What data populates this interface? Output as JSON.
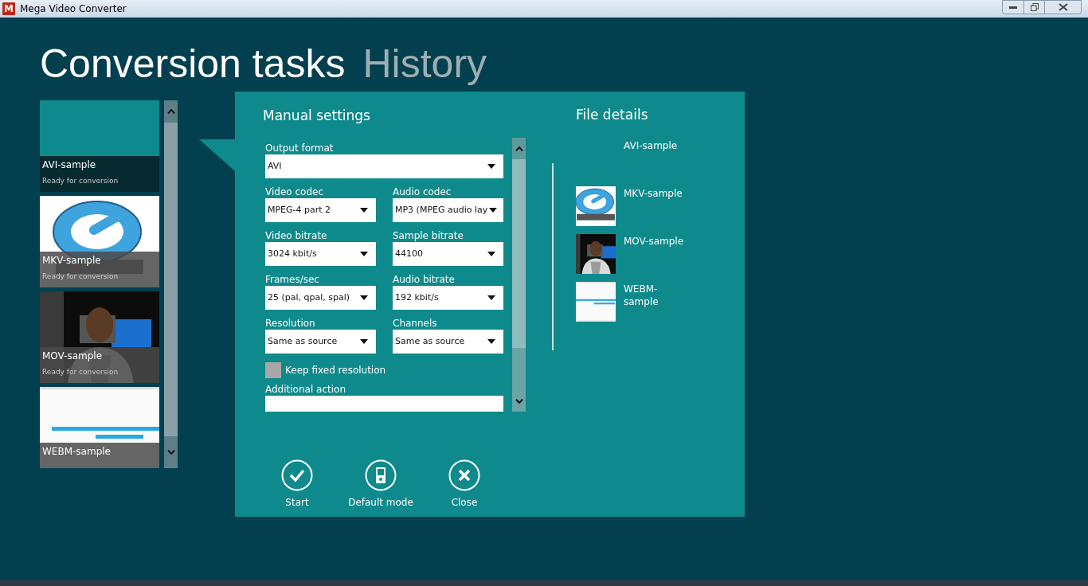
{
  "window": {
    "app_icon": "M",
    "title": "Mega Video Converter"
  },
  "heading_tabs": [
    {
      "label": "Conversion tasks",
      "selected": true
    },
    {
      "label": "History",
      "selected": false
    }
  ],
  "tasks": [
    {
      "name": "AVI-sample",
      "status": "Ready for conversion",
      "kind": "plain",
      "selected": true
    },
    {
      "name": "MKV-sample",
      "status": "Ready for conversion",
      "kind": "logo",
      "selected": false
    },
    {
      "name": "MOV-sample",
      "status": "Ready for conversion",
      "kind": "figure",
      "selected": false
    },
    {
      "name": "WEBM-sample",
      "kind": "banner",
      "selected": false
    }
  ],
  "manual_settings": {
    "title": "Manual settings",
    "fields": [
      {
        "label": "Output format",
        "value": "AVI",
        "kind": "full"
      },
      {
        "label": "Video codec",
        "value": "MPEG-4 part 2",
        "kind": "half"
      },
      {
        "label": "Audio codec",
        "value": "MP3 (MPEG audio lay",
        "kind": "half"
      },
      {
        "label": "Video bitrate",
        "value": "3024 kbit/s",
        "kind": "half"
      },
      {
        "label": "Sample bitrate",
        "value": "44100",
        "kind": "half"
      },
      {
        "label": "Frames/sec",
        "value": "25 (pal, qpal, spal)",
        "kind": "half"
      },
      {
        "label": "Audio bitrate",
        "value": "192 kbit/s",
        "kind": "half"
      },
      {
        "label": "Resolution",
        "value": "Same as source",
        "kind": "half"
      },
      {
        "label": "Channels",
        "value": "Same as source",
        "kind": "half"
      }
    ],
    "checkbox": {
      "label": "Keep fixed resolution",
      "checked": false
    },
    "additional_action": {
      "label": "Additional action"
    }
  },
  "file_details": {
    "title": "File details",
    "files": [
      {
        "name": "AVI-sample",
        "kind": "plain"
      },
      {
        "name": "MKV-sample",
        "kind": "logo"
      },
      {
        "name": "MOV-sample",
        "kind": "figure"
      },
      {
        "name": "WEBM-sample",
        "kind": "banner"
      }
    ]
  },
  "actions": [
    {
      "label": "Start",
      "kind": "check"
    },
    {
      "label": "Default mode",
      "kind": "player"
    },
    {
      "label": "Close",
      "kind": "close"
    }
  ]
}
